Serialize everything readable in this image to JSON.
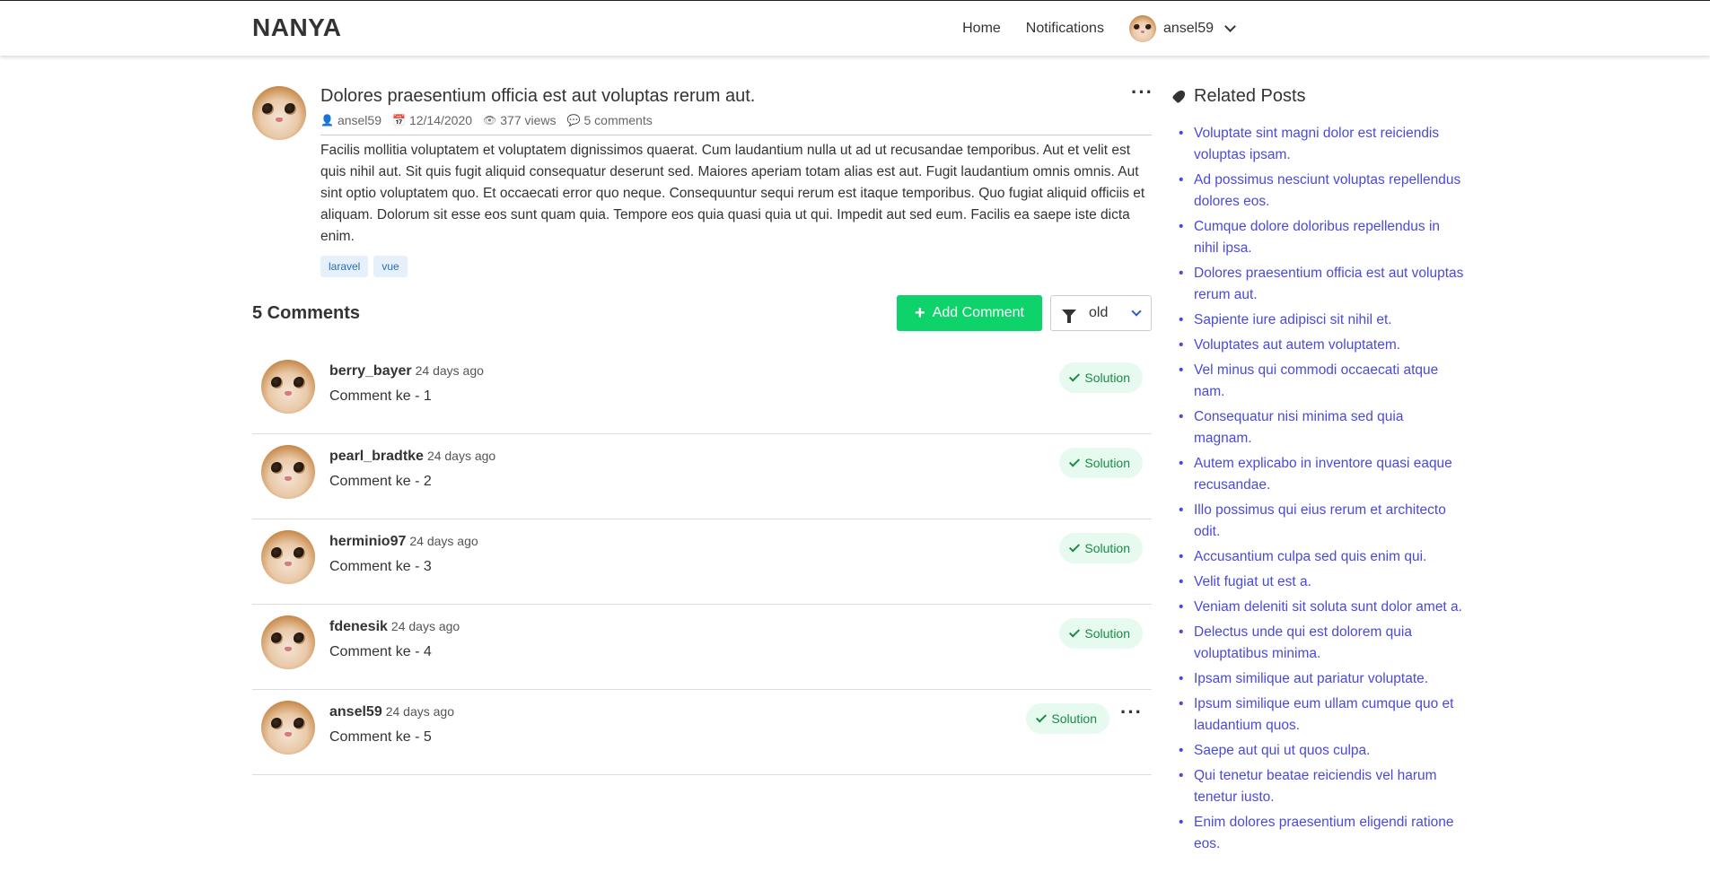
{
  "navbar": {
    "brand": "NANYA",
    "links": [
      "Home",
      "Notifications"
    ],
    "username": "ansel59"
  },
  "post": {
    "title": "Dolores praesentium officia est aut voluptas rerum aut.",
    "author": "ansel59",
    "date": "12/14/2020",
    "views": "377 views",
    "comments": "5 comments",
    "body": "Facilis mollitia voluptatem et voluptatem dignissimos quaerat. Cum laudantium nulla ut ad ut recusandae temporibus. Aut et velit est quis nihil aut. Sit quis fugit aliquid consequatur deserunt sed. Maiores aperiam totam alias est aut. Fugit laudantium omnis omnis. Aut sint optio voluptatem quo. Et occaecati error quo neque. Consequuntur sequi rerum est itaque temporibus. Quo fugiat aliquid officiis et aliquam. Dolorum sit esse eos sunt quam quia. Tempore eos quia quasi quia ut qui. Impedit aut sed eum. Facilis ea saepe iste dicta enim.",
    "tags": [
      "laravel",
      "vue"
    ]
  },
  "comments_section": {
    "title": "5 Comments",
    "add_label": "Add Comment",
    "filter_value": "old",
    "solution_label": "Solution",
    "items": [
      {
        "user": "berry_bayer",
        "time": "24 days ago",
        "text": "Comment ke - 1"
      },
      {
        "user": "pearl_bradtke",
        "time": "24 days ago",
        "text": "Comment ke - 2"
      },
      {
        "user": "herminio97",
        "time": "24 days ago",
        "text": "Comment ke - 3"
      },
      {
        "user": "fdenesik",
        "time": "24 days ago",
        "text": "Comment ke - 4"
      },
      {
        "user": "ansel59",
        "time": "24 days ago",
        "text": "Comment ke - 5"
      }
    ]
  },
  "sidebar": {
    "title": "Related Posts",
    "items": [
      "Voluptate sint magni dolor est reiciendis voluptas ipsam.",
      "Ad possimus nesciunt voluptas repellendus dolores eos.",
      "Cumque dolore doloribus repellendus in nihil ipsa.",
      "Dolores praesentium officia est aut voluptas rerum aut.",
      "Sapiente iure adipisci sit nihil et.",
      "Voluptates aut autem voluptatem.",
      "Vel minus qui commodi occaecati atque nam.",
      "Consequatur nisi minima sed quia magnam.",
      "Autem explicabo in inventore quasi eaque recusandae.",
      "Illo possimus qui eius rerum et architecto odit.",
      "Accusantium culpa sed quis enim qui.",
      "Velit fugiat ut est a.",
      "Veniam deleniti sit soluta sunt dolor amet a.",
      "Delectus unde qui est dolorem quia voluptatibus minima.",
      "Ipsam similique aut pariatur voluptate.",
      "Ipsum similique eum ullam cumque quo et laudantium quos.",
      "Saepe aut qui ut quos culpa.",
      "Qui tenetur beatae reiciendis vel harum tenetur iusto.",
      "Enim dolores praesentium eligendi ratione eos."
    ]
  },
  "colors": {
    "accent_green": "#0ed36a",
    "solution_bg": "#e7faef",
    "link_blue": "#4a4ad8",
    "tag_bg": "#e6f0fb"
  }
}
